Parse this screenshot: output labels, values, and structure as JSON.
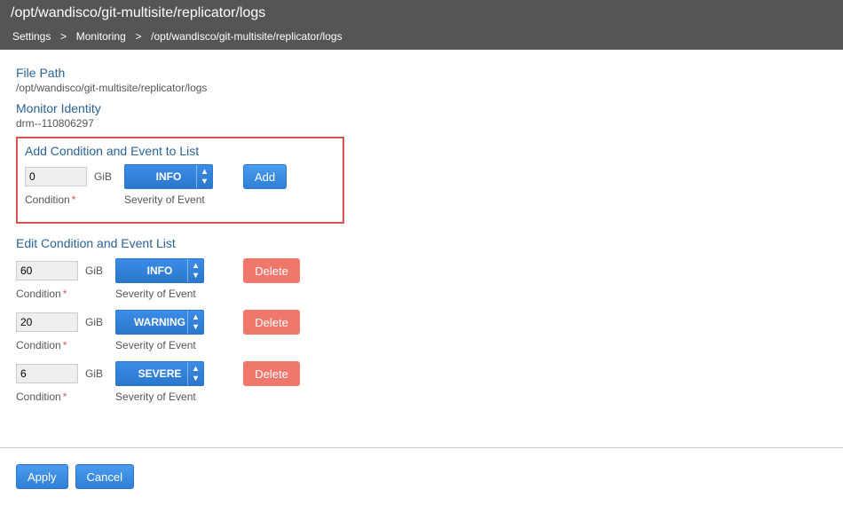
{
  "header": {
    "title": "/opt/wandisco/git-multisite/replicator/logs",
    "breadcrumb": [
      "Settings",
      "Monitoring",
      "/opt/wandisco/git-multisite/replicator/logs"
    ]
  },
  "filePath": {
    "label": "File Path",
    "value": "/opt/wandisco/git-multisite/replicator/logs"
  },
  "monitorIdentity": {
    "label": "Monitor Identity",
    "value": "drm--110806297"
  },
  "addSection": {
    "title": "Add Condition and Event to List",
    "conditionValue": "0",
    "unit": "GiB",
    "conditionLabel": "Condition",
    "severity": "INFO",
    "severityLabel": "Severity of Event",
    "addLabel": "Add"
  },
  "editSection": {
    "title": "Edit Condition and Event List",
    "unit": "GiB",
    "conditionLabel": "Condition",
    "severityLabel": "Severity of Event",
    "deleteLabel": "Delete",
    "rows": [
      {
        "value": "60",
        "severity": "INFO"
      },
      {
        "value": "20",
        "severity": "WARNING"
      },
      {
        "value": "6",
        "severity": "SEVERE"
      }
    ]
  },
  "footer": {
    "apply": "Apply",
    "cancel": "Cancel"
  }
}
